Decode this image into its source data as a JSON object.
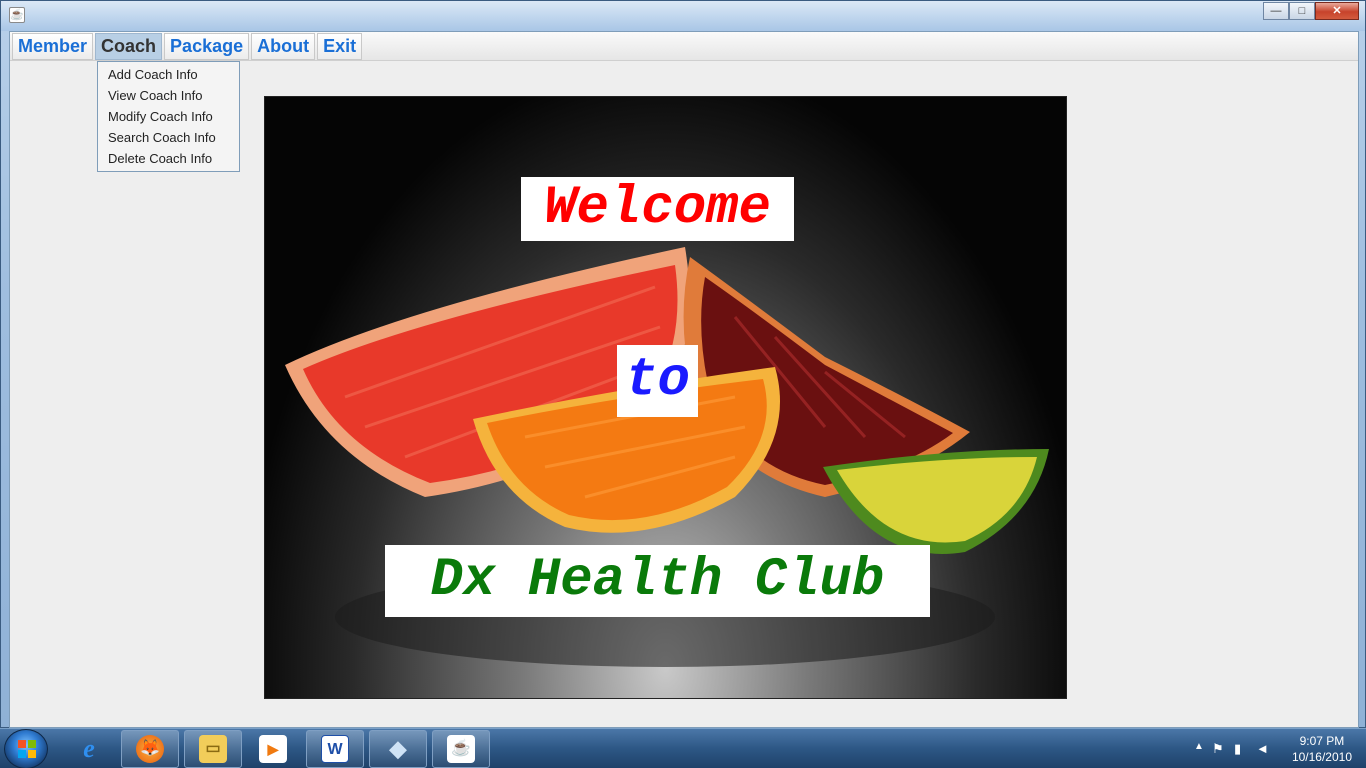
{
  "menubar": {
    "items": [
      {
        "label": "Member"
      },
      {
        "label": "Coach"
      },
      {
        "label": "Package"
      },
      {
        "label": "About"
      },
      {
        "label": "Exit"
      }
    ]
  },
  "coach_menu": {
    "items": [
      {
        "label": "Add Coach Info"
      },
      {
        "label": "View Coach Info"
      },
      {
        "label": "Modify Coach Info"
      },
      {
        "label": "Search Coach Info"
      },
      {
        "label": "Delete Coach Info"
      }
    ]
  },
  "banner": {
    "line1": "Welcome",
    "line2": "to",
    "line3": "Dx Health Club",
    "colors": {
      "line1": "#ff0000",
      "line2": "#1a1aff",
      "line3": "#0a7a0a"
    }
  },
  "taskbar": {
    "apps": [
      {
        "icon": "internet-explorer-icon",
        "glyph": "e"
      },
      {
        "icon": "firefox-icon",
        "glyph": "🦊"
      },
      {
        "icon": "folder-icon",
        "glyph": "▭"
      },
      {
        "icon": "media-player-icon",
        "glyph": "▶"
      },
      {
        "icon": "word-icon",
        "glyph": "W"
      },
      {
        "icon": "virtualbox-icon",
        "glyph": "◆"
      },
      {
        "icon": "java-icon",
        "glyph": "☕"
      }
    ],
    "tray": {
      "show_hidden": "▲"
    },
    "clock": {
      "time": "9:07 PM",
      "date": "10/16/2010"
    }
  }
}
